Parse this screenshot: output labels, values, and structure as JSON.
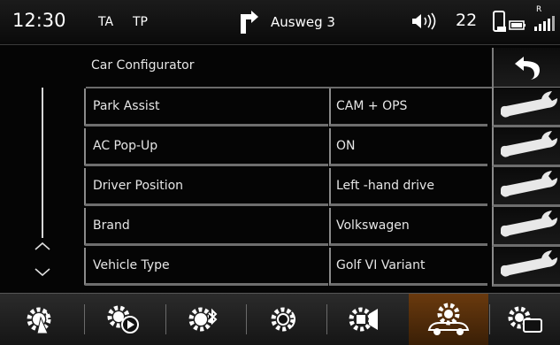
{
  "status_bar": {
    "time": "12:30",
    "ta": "TA",
    "tp": "TP",
    "nav_instruction": "Ausweg 3",
    "temperature": "22",
    "signal_label": "R",
    "icons": [
      "turn-right-icon",
      "volume-icon",
      "phone-battery-icon",
      "signal-strength-icon"
    ]
  },
  "header": {
    "title": "Car Configurator",
    "back_icon": "back-arrow-icon"
  },
  "settings": [
    {
      "label": "Park Assist",
      "value": "CAM + OPS"
    },
    {
      "label": "AC Pop-Up",
      "value": "ON"
    },
    {
      "label": "Driver Position",
      "value": "Left -hand drive"
    },
    {
      "label": "Brand",
      "value": "Volkswagen"
    },
    {
      "label": "Vehicle Type",
      "value": "Golf VI Variant"
    }
  ],
  "edit_icon": "wrench-icon",
  "scroll": {
    "up_icon": "chevron-up-icon",
    "down_icon": "chevron-down-icon"
  },
  "tabs": [
    {
      "name": "tab-radio-settings",
      "icon": "gear-antenna-icon",
      "active": false
    },
    {
      "name": "tab-media-settings",
      "icon": "gear-play-icon",
      "active": false
    },
    {
      "name": "tab-bluetooth-settings",
      "icon": "gear-bluetooth-icon",
      "active": false
    },
    {
      "name": "tab-sound-settings",
      "icon": "gear-sound-icon",
      "active": false
    },
    {
      "name": "tab-speaker-settings",
      "icon": "gear-speaker-icon",
      "active": false
    },
    {
      "name": "tab-car-settings",
      "icon": "gear-car-icon",
      "active": true
    },
    {
      "name": "tab-display-settings",
      "icon": "gear-display-icon",
      "active": false
    }
  ],
  "colors": {
    "background": "#000000",
    "active_tab": "#5a3210",
    "text": "#e6e6e6",
    "divider": "#6e6e6e"
  }
}
